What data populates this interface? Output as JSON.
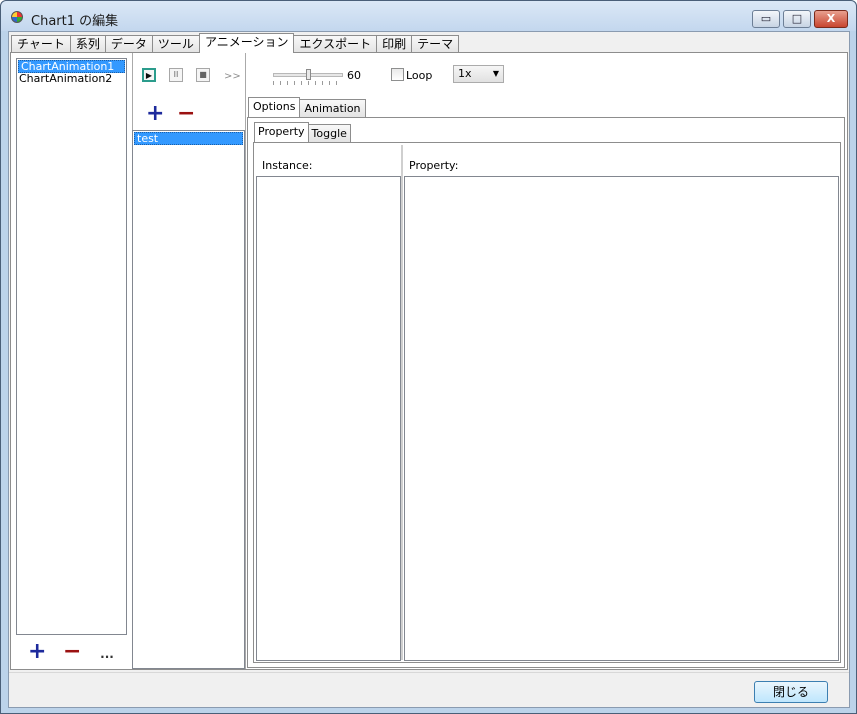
{
  "window": {
    "title": "Chart1 の編集",
    "minimize_symbol": "▭",
    "maximize_symbol": "□",
    "close_symbol": "X"
  },
  "tabs": [
    {
      "label": "チャート"
    },
    {
      "label": "系列"
    },
    {
      "label": "データ"
    },
    {
      "label": "ツール"
    },
    {
      "label": "アニメーション",
      "active": true
    },
    {
      "label": "エクスポート"
    },
    {
      "label": "印刷"
    },
    {
      "label": "テーマ"
    }
  ],
  "animations": {
    "items": [
      "ChartAnimation1",
      "ChartAnimation2"
    ],
    "selected_index": 0,
    "add_symbol": "+",
    "remove_symbol": "−",
    "more_symbol": "..."
  },
  "player": {
    "play_symbol": "▶",
    "pause_symbol": "II",
    "stop_symbol": "■",
    "fast_forward": ">>",
    "speed_value": 60,
    "speed_fraction": 0.5,
    "loop_label": "Loop",
    "loop_checked": false,
    "rate_selected": "1x"
  },
  "instances": {
    "add_symbol": "+",
    "remove_symbol": "−",
    "items": [
      "test"
    ],
    "selected_index": 0
  },
  "options_tabs": [
    {
      "label": "Options",
      "active": true
    },
    {
      "label": "Animation"
    }
  ],
  "sub_tabs": [
    {
      "label": "Property",
      "active": true
    },
    {
      "label": "Toggle"
    }
  ],
  "columns": {
    "instance_label": "Instance:",
    "property_label": "Property:"
  },
  "footer": {
    "close_label": "閉じる"
  },
  "colors": {
    "accent": "#3399ff",
    "add_color": "#1d2a9c",
    "remove_color": "#9b1111"
  }
}
